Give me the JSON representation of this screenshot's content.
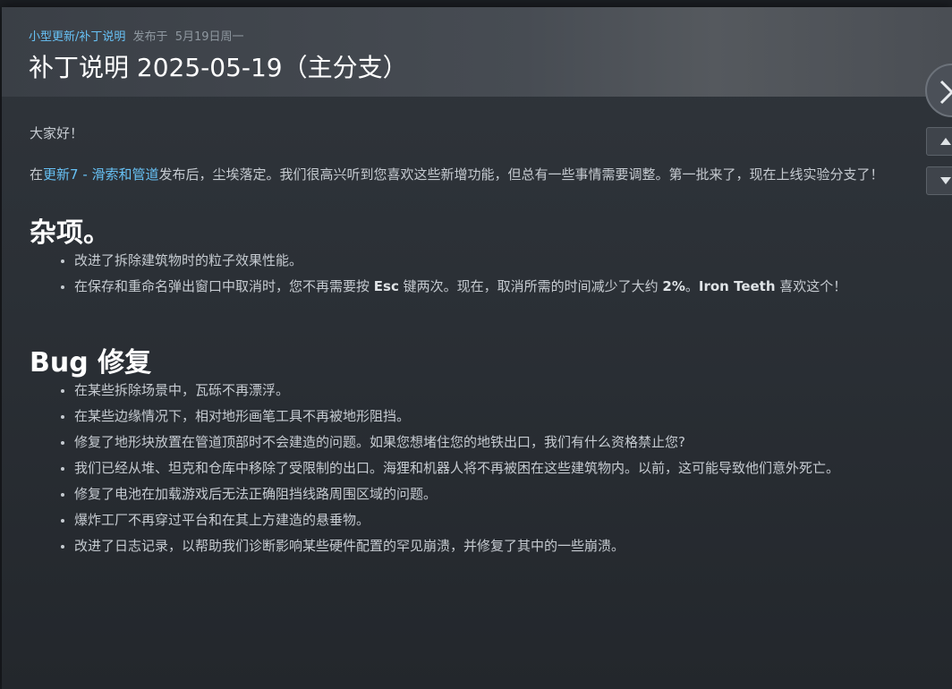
{
  "header": {
    "category": "小型更新/补丁说明",
    "posted_label": "发布于",
    "date": "5月19日周一",
    "title": "补丁说明 2025-05-19（主分支）"
  },
  "content": {
    "greeting": "大家好！",
    "intro_prefix": "在",
    "intro_link": "更新7 - 滑索和管道",
    "intro_suffix": "发布后，尘埃落定。我们很高兴听到您喜欢这些新增功能，但总有一些事情需要调整。第一批来了，现在上线实验分支了！",
    "misc": {
      "heading": "杂项。",
      "items": [
        "改进了拆除建筑物时的粒子效果性能。"
      ],
      "item2_a": "在保存和重命名弹出窗口中取消时，您不再需要按 ",
      "item2_b1": "Esc",
      "item2_c": " 键两次。现在，取消所需的时间减少了大约 ",
      "item2_b2": "2%",
      "item2_d": "。",
      "item2_b3": "Iron Teeth",
      "item2_e": " 喜欢这个！"
    },
    "bugs": {
      "heading": "Bug 修复",
      "items": [
        "在某些拆除场景中，瓦砾不再漂浮。",
        "在某些边缘情况下，相对地形画笔工具不再被地形阻挡。",
        "修复了地形块放置在管道顶部时不会建造的问题。如果您想堵住您的地铁出口，我们有什么资格禁止您?",
        "我们已经从堆、坦克和仓库中移除了受限制的出口。海狸和机器人将不再被困在这些建筑物内。以前，这可能导致他们意外死亡。",
        "修复了电池在加载游戏后无法正确阻挡线路周围区域的问题。",
        "爆炸工厂不再穿过平台和在其上方建造的悬垂物。",
        "改进了日志记录，以帮助我们诊断影响某些硬件配置的罕见崩溃，并修复了其中的一些崩溃。"
      ]
    }
  },
  "controls": {
    "close_icon": "close-icon",
    "prev_icon": "chevron-up-icon",
    "next_icon": "chevron-down-icon"
  },
  "colors": {
    "link": "#67c1f5",
    "text": "#c6cbd1",
    "heading": "#ffffff"
  }
}
